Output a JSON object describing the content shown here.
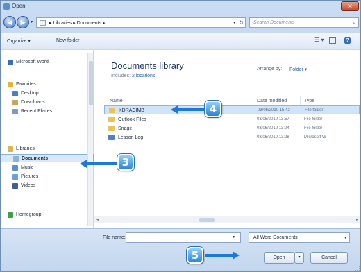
{
  "window": {
    "title": "Open",
    "close_glyph": "✕"
  },
  "address": {
    "back_glyph": "◀",
    "forward_glyph": "▶",
    "path": "▸ Libraries ▸ Documents ▸",
    "dropdown_glyph": "▾",
    "refresh_glyph": "↻",
    "search_placeholder": "Search Documents",
    "search_glyph": "⌕"
  },
  "toolbar": {
    "organize_label": "Organize ▾",
    "new_folder_label": "New folder",
    "views_glyph": "☷ ▾",
    "help_glyph": "?"
  },
  "nav": {
    "items": [
      {
        "label": "Microsoft Word",
        "icon": "word-icon",
        "color": "#3b6cc2"
      },
      {
        "label": "Favorites",
        "icon": "star-icon",
        "color": "#e8b23a"
      },
      {
        "label": "Desktop",
        "icon": "desktop-icon",
        "color": "#4a7ec8"
      },
      {
        "label": "Downloads",
        "icon": "downloads-icon",
        "color": "#c9a45a"
      },
      {
        "label": "Recent Places",
        "icon": "recent-places-icon",
        "color": "#7a9bc4"
      },
      {
        "label": "Libraries",
        "icon": "libraries-icon",
        "color": "#e0b54c"
      },
      {
        "label": "Documents",
        "icon": "documents-icon",
        "color": "#8fb0d8"
      },
      {
        "label": "Music",
        "icon": "music-icon",
        "color": "#5a8fd0"
      },
      {
        "label": "Pictures",
        "icon": "pictures-icon",
        "color": "#6aa0d8"
      },
      {
        "label": "Videos",
        "icon": "videos-icon",
        "color": "#3f5f8f"
      },
      {
        "label": "Homegroup",
        "icon": "homegroup-icon",
        "color": "#3aa04a"
      }
    ]
  },
  "content": {
    "library_title": "Documents library",
    "includes_text": "Includes:",
    "includes_link": "2 locations",
    "arrange_label": "Arrange by:",
    "arrange_value": "Folder ▾",
    "columns": {
      "name": "Name",
      "date": "Date modified",
      "type": "Type"
    },
    "files": [
      {
        "name": "KDRACIMB",
        "date": "03/06/2010 15:42",
        "type": "File folder",
        "icon": "folder-icon",
        "color": "#e8c35a"
      },
      {
        "name": "Outlook Files",
        "date": "03/06/2010 13:57",
        "type": "File folder",
        "icon": "folder-icon",
        "color": "#e8c35a"
      },
      {
        "name": "Snagit",
        "date": "03/06/2010 13:04",
        "type": "File folder",
        "icon": "folder-icon",
        "color": "#e8c35a"
      },
      {
        "name": "Lesson Log",
        "date": "03/06/2010 13:28",
        "type": "Microsoft W",
        "icon": "word-document-icon",
        "color": "#4f7fcf"
      }
    ]
  },
  "scroll": {
    "left_glyph": "◂",
    "right_glyph": "▸",
    "up_glyph": "▴",
    "down_glyph": "▾"
  },
  "footer": {
    "filename_label": "File name:",
    "filename_value": "",
    "dropdown_glyph": "▾",
    "filter_value": "All Word Documents",
    "open_label": "Open",
    "open_split_glyph": "▾",
    "cancel_label": "Cancel"
  },
  "callouts": {
    "c3": "3",
    "c4": "4",
    "c5": "5",
    "color": "#1d79d8"
  }
}
